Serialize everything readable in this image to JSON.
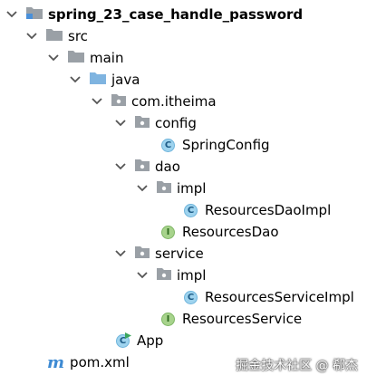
{
  "project_tree": {
    "root": {
      "label": "spring_23_case_handle_password"
    },
    "src": {
      "label": "src"
    },
    "main": {
      "label": "main"
    },
    "java": {
      "label": "java"
    },
    "package": {
      "label": "com.itheima"
    },
    "config": {
      "label": "config"
    },
    "spring_config": {
      "label": "SpringConfig"
    },
    "dao": {
      "label": "dao"
    },
    "dao_impl": {
      "label": "impl"
    },
    "resources_dao_impl": {
      "label": "ResourcesDaoImpl"
    },
    "resources_dao": {
      "label": "ResourcesDao"
    },
    "service": {
      "label": "service"
    },
    "service_impl": {
      "label": "impl"
    },
    "resources_service_impl": {
      "label": "ResourcesServiceImpl"
    },
    "resources_service": {
      "label": "ResourcesService"
    },
    "app": {
      "label": "App"
    },
    "pom": {
      "label": "pom.xml"
    }
  },
  "icons": {
    "class_letter": "C",
    "interface_letter": "I",
    "maven_letter": "m"
  },
  "watermark": "掘金技术社区 @ 郗杰"
}
